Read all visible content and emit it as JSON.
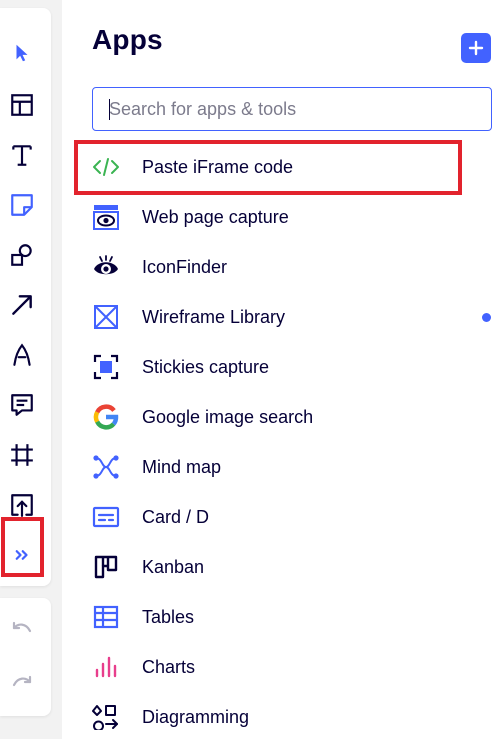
{
  "toolbar": {
    "tools": [
      {
        "name": "select-tool",
        "icon": "cursor-icon"
      },
      {
        "name": "templates-tool",
        "icon": "layout-icon"
      },
      {
        "name": "text-tool",
        "icon": "text-icon"
      },
      {
        "name": "sticky-note-tool",
        "icon": "sticky-note-icon"
      },
      {
        "name": "shapes-tool",
        "icon": "shapes-icon"
      },
      {
        "name": "connection-line-tool",
        "icon": "arrow-icon"
      },
      {
        "name": "pen-tool",
        "icon": "pen-icon"
      },
      {
        "name": "comment-tool",
        "icon": "comment-icon"
      },
      {
        "name": "frame-tool",
        "icon": "frame-icon"
      },
      {
        "name": "upload-tool",
        "icon": "upload-icon"
      },
      {
        "name": "more-apps-tool",
        "icon": "double-chevron-right-icon"
      }
    ],
    "undo_icon": "undo-icon",
    "redo_icon": "redo-icon"
  },
  "apps_panel": {
    "title": "Apps",
    "add_icon": "plus-icon",
    "search": {
      "placeholder": "Search for apps & tools",
      "value": ""
    },
    "items": [
      {
        "label": "Paste iFrame code",
        "icon": "code-icon"
      },
      {
        "label": "Web page capture",
        "icon": "web-capture-icon"
      },
      {
        "label": "IconFinder",
        "icon": "iconfinder-icon"
      },
      {
        "label": "Wireframe Library",
        "icon": "wireframe-icon"
      },
      {
        "label": "Stickies capture",
        "icon": "stickies-capture-icon"
      },
      {
        "label": "Google image search",
        "icon": "google-icon"
      },
      {
        "label": "Mind map",
        "icon": "mind-map-icon"
      },
      {
        "label": "Card / D",
        "icon": "card-icon"
      },
      {
        "label": "Kanban",
        "icon": "kanban-icon"
      },
      {
        "label": "Tables",
        "icon": "table-icon"
      },
      {
        "label": "Charts",
        "icon": "chart-icon"
      },
      {
        "label": "Diagramming",
        "icon": "diagramming-icon"
      }
    ]
  },
  "colors": {
    "accent": "#4262ff",
    "highlight": "#e2232d",
    "text": "#050038"
  }
}
